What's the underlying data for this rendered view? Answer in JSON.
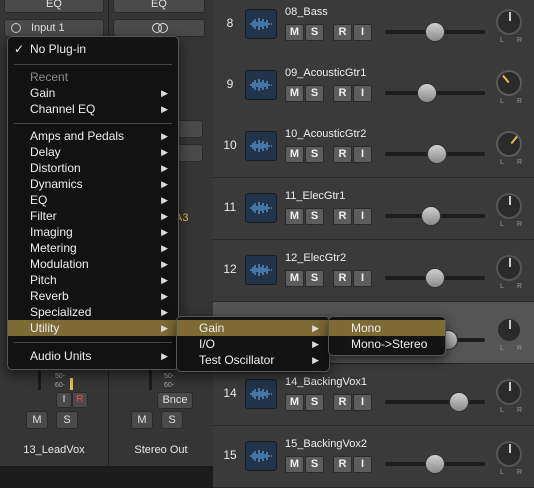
{
  "mixer": {
    "strip1": {
      "eq_label": "EQ",
      "input_label": "Input 1",
      "rec_label": "R",
      "mute": "M",
      "solo": "S",
      "name": "13_LeadVox",
      "meter_ticks": [
        "50-",
        "60-"
      ]
    },
    "strip2": {
      "eq_label": "EQ",
      "link_icon": "stereo-link-icon",
      "bounce_label": "Bnce",
      "mute": "M",
      "solo": "S",
      "name": "Stereo Out",
      "meter_ticks": [
        "50-",
        "60-"
      ],
      "partial_label": "A3"
    }
  },
  "tracks": [
    {
      "num": "8",
      "name": "08_Bass",
      "mute": "M",
      "solo": "S",
      "rec": "R",
      "input": "I",
      "pan": "C",
      "pan_color": "#ccc"
    },
    {
      "num": "9",
      "name": "09_AcousticGtr1",
      "mute": "M",
      "solo": "S",
      "rec": "R",
      "input": "I",
      "pan": "L",
      "pan_color": "#e8b85a"
    },
    {
      "num": "10",
      "name": "10_AcousticGtr2",
      "mute": "M",
      "solo": "S",
      "rec": "R",
      "input": "I",
      "pan": "R",
      "pan_color": "#e8b85a"
    },
    {
      "num": "11",
      "name": "11_ElecGtr1",
      "mute": "M",
      "solo": "S",
      "rec": "R",
      "input": "I",
      "pan": "C",
      "pan_color": "#ccc"
    },
    {
      "num": "12",
      "name": "12_ElecGtr2",
      "mute": "M",
      "solo": "S",
      "rec": "R",
      "input": "I",
      "pan": "C",
      "pan_color": "#ccc"
    },
    {
      "num": "",
      "name": "",
      "mute": "",
      "solo": "",
      "rec": "",
      "input": "",
      "pan": "C",
      "pan_color": "#ccc"
    },
    {
      "num": "14",
      "name": "14_BackingVox1",
      "mute": "M",
      "solo": "S",
      "rec": "R",
      "input": "I",
      "pan": "C",
      "pan_color": "#ccc"
    },
    {
      "num": "15",
      "name": "15_BackingVox2",
      "mute": "M",
      "solo": "S",
      "rec": "R",
      "input": "I",
      "pan": "C",
      "pan_color": "#ccc"
    }
  ],
  "knob_labels": {
    "l": "L",
    "r": "R"
  },
  "plugin_menu": {
    "no_plugin": "No Plug-in",
    "recent_header": "Recent",
    "recent": [
      "Gain",
      "Channel EQ"
    ],
    "categories": [
      "Amps and Pedals",
      "Delay",
      "Distortion",
      "Dynamics",
      "EQ",
      "Filter",
      "Imaging",
      "Metering",
      "Modulation",
      "Pitch",
      "Reverb",
      "Specialized",
      "Utility"
    ],
    "audio_units": "Audio Units",
    "selected": "Utility"
  },
  "utility_menu": {
    "items": [
      "Gain",
      "I/O",
      "Test Oscillator"
    ],
    "selected": "Gain"
  },
  "gain_menu": {
    "items": [
      "Mono",
      "Mono->Stereo"
    ],
    "selected": "Mono"
  },
  "colors": {
    "highlight": "#7e6a35",
    "accent_orange": "#e8b85a",
    "record_red": "#e05050"
  }
}
